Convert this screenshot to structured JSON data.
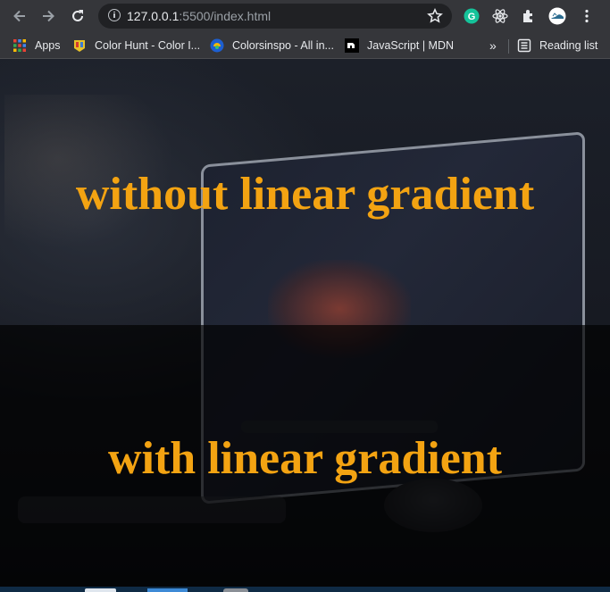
{
  "browser": {
    "url_host": "127.0.0.1",
    "url_path": ":5500/index.html",
    "nav": {
      "back_icon": "arrow-left-icon",
      "forward_icon": "arrow-right-icon",
      "reload_icon": "reload-icon"
    },
    "extensions": [
      "grammarly-icon",
      "react-devtools-icon",
      "extensions-puzzle-icon",
      "profile-avatar-icon",
      "menu-dots-icon"
    ]
  },
  "bookmarks": {
    "items": [
      {
        "label": "Apps",
        "icon": "apps-grid-icon"
      },
      {
        "label": "Color Hunt - Color I...",
        "icon": "color-hunt-icon"
      },
      {
        "label": "Colorsinspo - All in...",
        "icon": "colorsinspo-icon"
      },
      {
        "label": "JavaScript | MDN",
        "icon": "mdn-icon"
      }
    ],
    "overflow": "»",
    "reading_list": "Reading list"
  },
  "page": {
    "heading_top": "without linear gradient",
    "heading_bottom": "with linear gradient",
    "accent_color": "#f3a312"
  }
}
